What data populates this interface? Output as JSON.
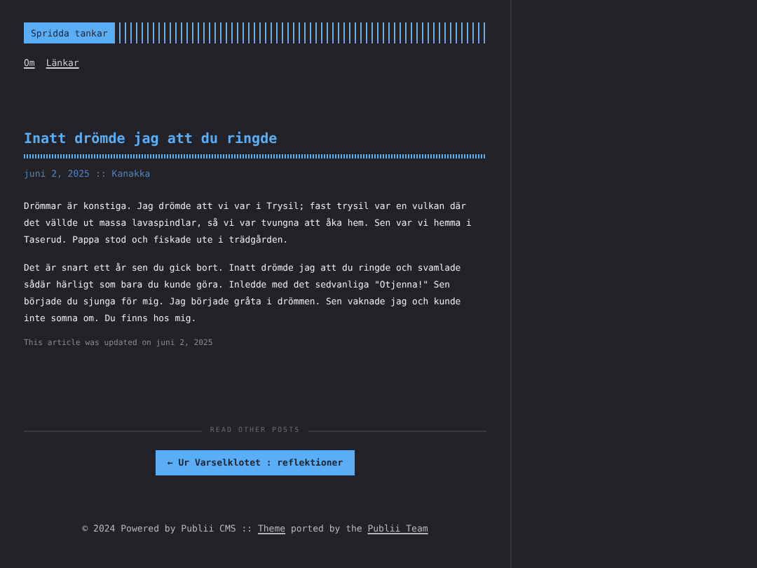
{
  "header": {
    "logo": "Spridda tankar",
    "nav": [
      {
        "label": "Om"
      },
      {
        "label": "Länkar"
      }
    ]
  },
  "post": {
    "title": "Inatt drömde jag att du ringde",
    "date": "juni 2, 2025",
    "separator": "::",
    "author": "Kanakka",
    "paragraphs": [
      "Drömmar är konstiga. Jag drömde att vi var i Trysil; fast trysil var en vulkan där det vällde ut massa lavaspindlar, så vi var tvungna att åka hem. Sen var vi hemma i Taserud. Pappa stod och fiskade ute i trädgården.",
      "Det är snart ett år sen du gick bort. Inatt drömde jag att du ringde och svamlade sådär härligt som bara du kunde göra. Inledde med det sedvanliga \"Otjenna!\" Sen började du sjunga för mig. Jag började gråta i drömmen. Sen vaknade jag och kunde inte somna om. Du finns hos mig."
    ],
    "updated": "This article was updated on juni 2, 2025"
  },
  "other_posts": {
    "heading": "READ OTHER POSTS",
    "previous": "← Ur Varselklotet : reflektioner"
  },
  "footer": {
    "text_1": "© 2024 Powered by Publii CMS :: ",
    "link_1": "Theme",
    "text_2": " ported by the ",
    "link_2": "Publii Team"
  }
}
